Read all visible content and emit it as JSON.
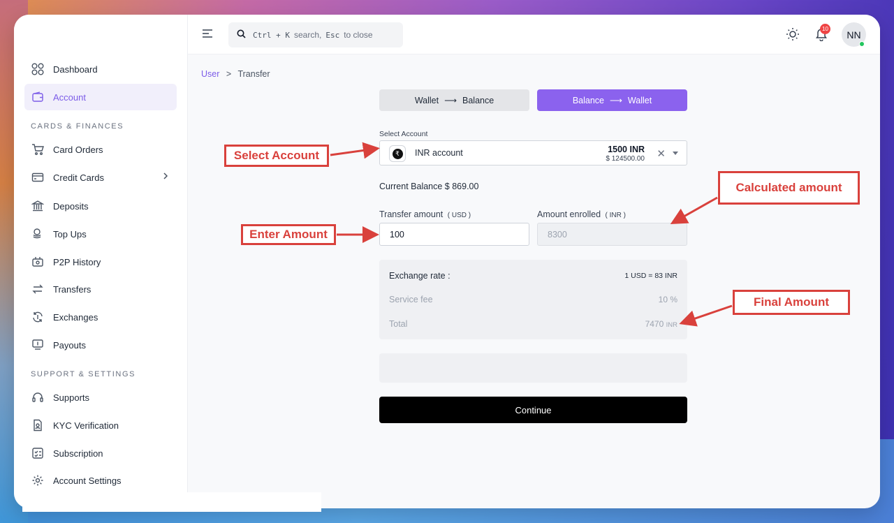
{
  "topbar": {
    "search_kbd1": "Ctrl + K",
    "search_txt1": "search,",
    "search_kbd2": "Esc",
    "search_txt2": "to close",
    "notification_count": "10",
    "avatar_initials": "NN"
  },
  "sidebar": {
    "items": [
      {
        "label": "Dashboard",
        "icon": "grid-icon"
      },
      {
        "label": "Account",
        "icon": "wallet-icon"
      },
      {
        "label": "Card Orders",
        "icon": "cart-icon"
      },
      {
        "label": "Credit Cards",
        "icon": "credit-card-icon"
      },
      {
        "label": "Deposits",
        "icon": "bank-icon"
      },
      {
        "label": "Top Ups",
        "icon": "coins-icon"
      },
      {
        "label": "P2P History",
        "icon": "p2p-icon"
      },
      {
        "label": "Transfers",
        "icon": "transfer-icon"
      },
      {
        "label": "Exchanges",
        "icon": "exchange-icon"
      },
      {
        "label": "Payouts",
        "icon": "payout-icon"
      },
      {
        "label": "Supports",
        "icon": "headset-icon"
      },
      {
        "label": "KYC Verification",
        "icon": "kyc-icon"
      },
      {
        "label": "Subscription",
        "icon": "subscription-icon"
      },
      {
        "label": "Account Settings",
        "icon": "gear-icon"
      }
    ],
    "section_cards": "CARDS & FINANCES",
    "section_support": "SUPPORT & SETTINGS"
  },
  "breadcrumb": {
    "parent": "User",
    "separator": ">",
    "current": "Transfer"
  },
  "tabs": {
    "left_from": "Wallet",
    "left_to": "Balance",
    "right_from": "Balance",
    "right_to": "Wallet",
    "arrow": "⟶"
  },
  "form": {
    "select_label": "Select Account",
    "account_name": "INR account",
    "account_amount": "1500 INR",
    "account_usd": "$ 124500.00",
    "current_balance": "Current Balance $ 869.00",
    "transfer_label": "Transfer amount",
    "transfer_unit": "( USD )",
    "transfer_value": "100",
    "enrolled_label": "Amount enrolled",
    "enrolled_unit": "( INR )",
    "enrolled_value": "8300"
  },
  "summary": {
    "rate_label": "Exchange rate :",
    "rate_value": "1 USD = 83 INR",
    "fee_label": "Service fee",
    "fee_value": "10 %",
    "total_label": "Total",
    "total_value": "7470",
    "total_unit": "INR"
  },
  "continue_label": "Continue",
  "callouts": {
    "select_account": "Select Account",
    "calculated_amount": "Calculated amount",
    "enter_amount": "Enter Amount",
    "final_amount": "Final Amount"
  },
  "colors": {
    "accent": "#8b62ee",
    "annotation": "#d9413c",
    "button": "#000000"
  }
}
